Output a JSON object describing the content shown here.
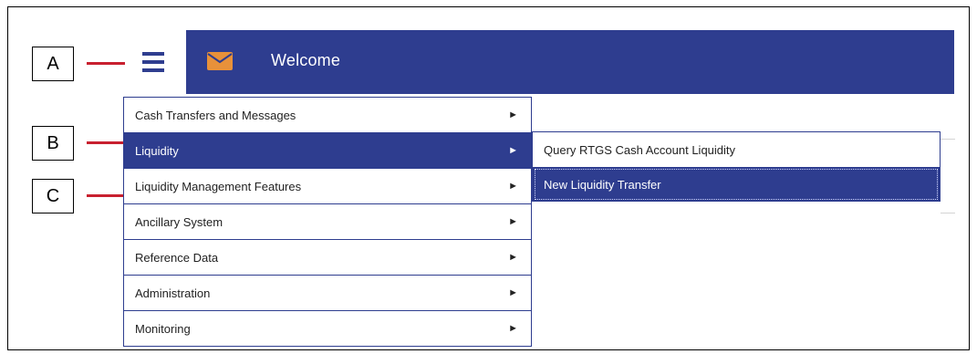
{
  "header": {
    "title": "Welcome",
    "icons": {
      "menu": "hamburger-menu-icon",
      "mail": "envelope-icon"
    }
  },
  "annotations": [
    "A",
    "B",
    "C"
  ],
  "menu": {
    "items": [
      {
        "label": "Cash Transfers and Messages",
        "active": false
      },
      {
        "label": "Liquidity",
        "active": true
      },
      {
        "label": "Liquidity Management Features",
        "active": false
      },
      {
        "label": "Ancillary System",
        "active": false
      },
      {
        "label": "Reference Data",
        "active": false
      },
      {
        "label": "Administration",
        "active": false
      },
      {
        "label": "Monitoring",
        "active": false
      }
    ],
    "arrow": "►"
  },
  "submenu": {
    "items": [
      {
        "label": "Query RTGS Cash Account Liquidity",
        "active": false
      },
      {
        "label": "New Liquidity Transfer",
        "active": true
      }
    ]
  },
  "colors": {
    "primary": "#2e3d8f",
    "accent_envelope": "#e8913a",
    "annotation_line": "#c8202f"
  }
}
